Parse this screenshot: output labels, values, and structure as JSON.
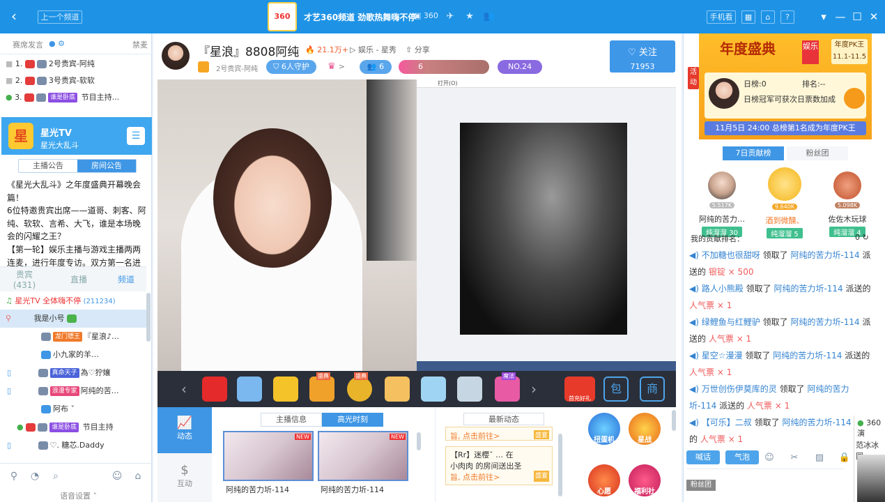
{
  "topbar": {
    "prev_channel": "上一个频道",
    "logo": "360",
    "title": "才艺360频道 劲歌热舞嗨不停",
    "channel_id": "360",
    "phone_view": "手机看"
  },
  "left": {
    "header_title": "赛席发言",
    "header_right": "禁麦",
    "vip_rows": [
      {
        "rank": "1.",
        "name": "2号贵宾-阿纯"
      },
      {
        "rank": "2.",
        "name": "3号贵宾-软软"
      },
      {
        "rank": "3.",
        "badge": "谁是卧底",
        "name": "节目主持..."
      }
    ],
    "room_name": "星光TV",
    "room_sub": "星光大乱斗",
    "notice_tabs": [
      "主播公告",
      "房间公告"
    ],
    "notice_text": "《星光大乱斗》之年度盛典开幕晚会篇！\n6位特邀贵宾出席——道哥、刺客、阿纯、软软、言希、大飞，谁是本场晚会的闪耀之王？\n【第一轮】娱乐主播与游戏主播两两连麦，进行年度专访。双方第一名进",
    "list_tabs": [
      {
        "label": "贵宾",
        "count": "(431)"
      },
      {
        "label": "直播"
      },
      {
        "label": "频道"
      }
    ],
    "channel_line": {
      "name": "星光TV",
      "slogan": "全体嗨不停",
      "count": "(211234)"
    },
    "users": [
      {
        "name": "我是小号"
      },
      {
        "badge": "龙门镖王",
        "name": "『星浪♪…"
      },
      {
        "name": "小九家的羊…"
      },
      {
        "badge": "真命天子",
        "name": "為♡狞孃"
      },
      {
        "badge": "浪漫专家",
        "name": "阿纯的苦…"
      },
      {
        "name": "阿布 ˇ"
      },
      {
        "badge": "谁是卧底",
        "name": "节目主持"
      },
      {
        "name": "♡. 糖芯.Daddy"
      }
    ],
    "voice_settings": "语音设置"
  },
  "center": {
    "anchor_name": "『星浪』8808阿纯",
    "hot": "21.1万+",
    "category": "娱乐 - 星秀",
    "share": "分享",
    "guest_label": "2号贵宾-阿纯",
    "guard_count": "6人守护",
    "fans_count": "6",
    "heart_count": "6",
    "rank_label": "NO.24",
    "follow_label": "关注",
    "follow_count": "71953",
    "screen_menu": "打开(O)",
    "gift_badges": [
      "盛典",
      "盛典",
      "魔法"
    ],
    "gift_right": "首充好礼",
    "nav_dynamic": "动态",
    "nav_interact": "互动",
    "highlight_tabs": [
      "主播信息",
      "高光时刻"
    ],
    "new_badge": "NEW",
    "thumbs": [
      "阿纯的苦力圻-114",
      "阿纯的苦力圻-114"
    ],
    "news_title": "最新动态",
    "news_items": [
      {
        "line1": "旨, 点击前往>",
        "tag": "盛宴"
      },
      {
        "line1": "【Rr】迷櫻ˇ … 在",
        "line2": "小肉肉 的房间送出圣",
        "line3": "旨, 点击前往>",
        "tag": "盛宴"
      }
    ],
    "activities": [
      {
        "label": "扭蛋机"
      },
      {
        "label": "星战"
      },
      {
        "label": "心愿"
      },
      {
        "label": "福利社"
      }
    ]
  },
  "right": {
    "side_tab": "活动",
    "banner_title": "年度盛典",
    "banner_tag": "娱乐",
    "pk_label": "年度PK王",
    "pk_dates": "11.1-11.5",
    "daily_rank": "日榜:0",
    "rank_label": "排名:--",
    "rank_desc": "日榜冠军可获次日票数加成",
    "banner_bottom": "11月5日 24:00 总榜第1名成为年度PK王",
    "tabs": [
      "7日贡献榜",
      "粉丝团"
    ],
    "top3": [
      {
        "score": "5.517K",
        "name": "阿纯的苦力…",
        "level": "纯溜溜",
        "lv": "30"
      },
      {
        "score": "9.640K",
        "name": "酒到微醺、",
        "level": "纯溜溜",
        "lv": "5"
      },
      {
        "score": "5.098K",
        "name": "佐佐木玩球",
        "level": "纯溜溜",
        "lv": "4"
      }
    ],
    "my_rank_label": "我的贡献排名：",
    "my_rank_value": "0",
    "feed": [
      {
        "user": "不加糖也很甜呀",
        "action": "领取了",
        "target": "阿纯的苦力圻-114",
        "sent": "派送的",
        "item": "银锭",
        "qty": "× 500"
      },
      {
        "user": "路人小熊殿",
        "action": "领取了",
        "target": "阿纯的苦力圻-114",
        "sent": "派送的",
        "item": "人气票",
        "qty": "× 1"
      },
      {
        "user": "绿鲤鱼与红鲤驴",
        "action": "领取了",
        "target": "阿纯的苦力圻-114",
        "sent": "派送的",
        "item": "人气票",
        "qty": "× 1"
      },
      {
        "user": "星空☆漫漫",
        "action": "领取了",
        "target": "阿纯的苦力圻-114",
        "sent": "派送的",
        "item": "人气票",
        "qty": "× 1"
      },
      {
        "user": "万世创伤伊莫库的灵",
        "action": "领取了",
        "target": "阿纯的苦力圻-114",
        "sent": "派送的",
        "item": "人气票",
        "qty": "× 1"
      },
      {
        "user": "【可乐】二叔",
        "action": "领取了",
        "target": "阿纯的苦力圻-114",
        "sent": "派送的",
        "item": "人气票",
        "qty": "× 1"
      }
    ],
    "chat_buttons": [
      "喊话",
      "气泡"
    ],
    "fan_group": "粉丝团",
    "mini_360": "360演",
    "mini_name": "范冰冰同"
  }
}
